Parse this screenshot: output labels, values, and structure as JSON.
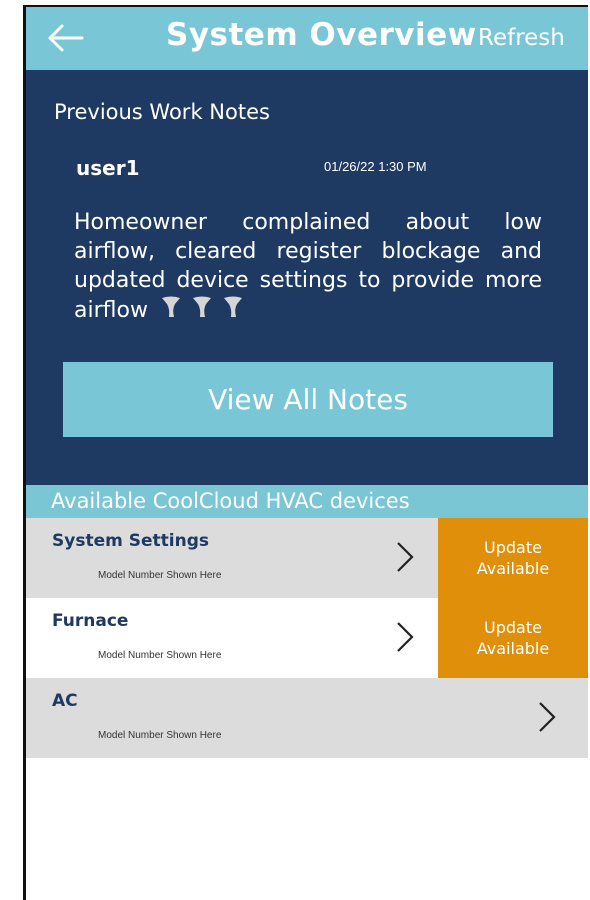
{
  "header": {
    "title": "System Overview",
    "refresh_label": "Refresh",
    "back_icon": "arrow-left-icon"
  },
  "notes": {
    "heading": "Previous Work Notes",
    "user": "user1",
    "timestamp": "01/26/22  1:30 PM",
    "body": "Homeowner complained about low airflow, cleared register blockage and updated device settings to provide more airflow",
    "button_label": "View All Notes"
  },
  "devices": {
    "heading": "Available CoolCloud HVAC devices",
    "items": [
      {
        "name": "System Settings",
        "model": "Model Number Shown Here",
        "update_line1": "Update",
        "update_line2": "Available"
      },
      {
        "name": "Furnace",
        "model": "Model Number Shown Here",
        "update_line1": "Update",
        "update_line2": "Available"
      },
      {
        "name": "AC",
        "model": "Model Number Shown Here"
      }
    ]
  },
  "colors": {
    "header": "#79c7d6",
    "notes_bg": "#1f3a62",
    "update": "#df8f0a",
    "row_gray": "#dcdcdc"
  }
}
